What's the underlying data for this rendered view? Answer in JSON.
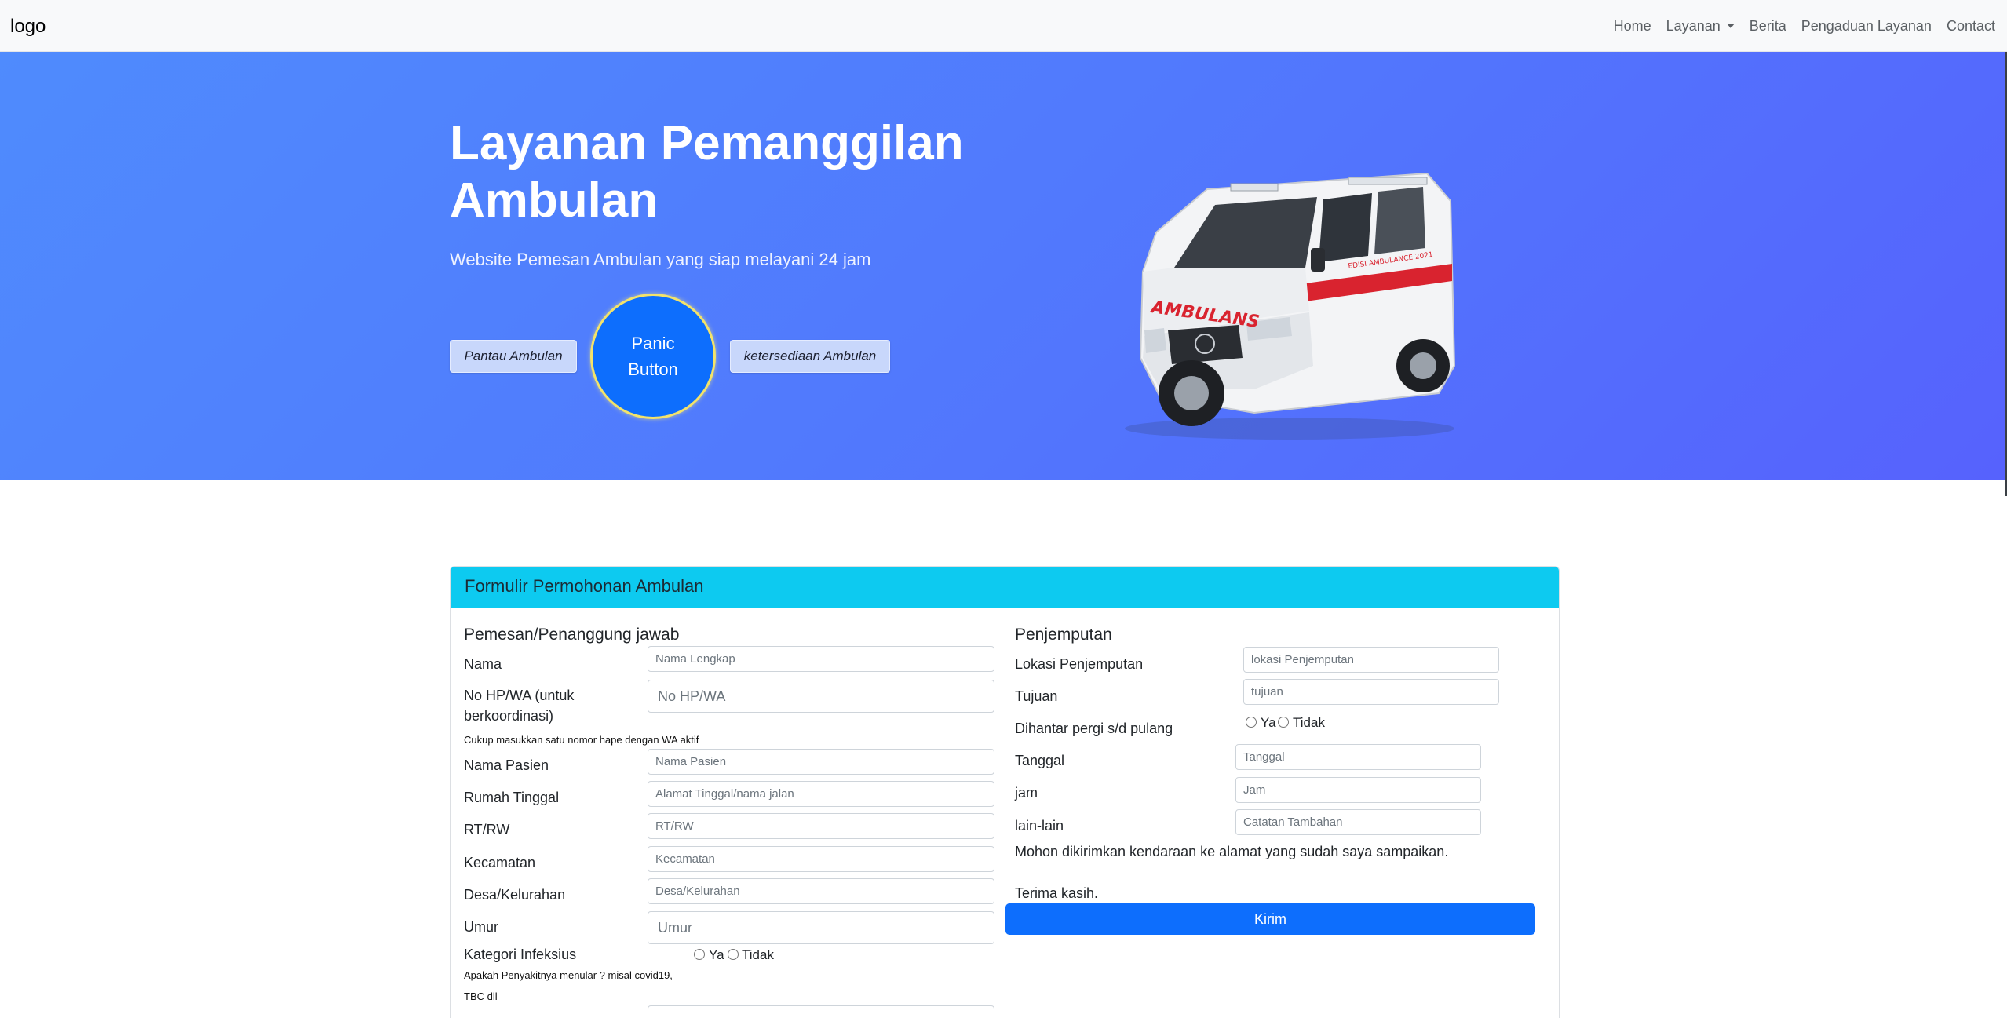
{
  "navbar": {
    "brand": "logo",
    "links": [
      "Home",
      "Layanan",
      "Berita",
      "Pengaduan Layanan",
      "Contact"
    ]
  },
  "hero": {
    "title": "Layanan Pemanggilan Ambulan",
    "subtitle": "Website Pemesan Ambulan yang siap melayani 24 jam",
    "btn_pantau": "Pantau Ambulan",
    "btn_panic_line1": "Panic",
    "btn_panic_line2": "Button",
    "btn_ketersediaan": "ketersediaan Ambulan",
    "ambulance_text": "AMBULANS",
    "ambulance_side_text": "EDISI AMBULANCE 2021"
  },
  "form": {
    "title": "Formulir Permohonan Ambulan",
    "left": {
      "section": "Pemesan/Penanggung jawab",
      "nama_label": "Nama",
      "nama_placeholder": "Nama Lengkap",
      "hp_label_1": "No HP/WA (untuk",
      "hp_label_2": "berkoordinasi)",
      "hp_placeholder": "No HP/WA",
      "hp_help": "Cukup masukkan satu nomor hape dengan WA aktif",
      "pasien_label": "Nama Pasien",
      "pasien_placeholder": "Nama Pasien",
      "rumah_label": "Rumah Tinggal",
      "rumah_placeholder": "Alamat Tinggal/nama jalan",
      "rtrw_label": "RT/RW",
      "rtrw_placeholder": "RT/RW",
      "kecamatan_label": "Kecamatan",
      "kecamatan_placeholder": "Kecamatan",
      "desa_label": "Desa/Kelurahan",
      "desa_placeholder": "Desa/Kelurahan",
      "umur_label": "Umur",
      "umur_placeholder": "Umur",
      "infeksi_label": "Kategori Infeksius",
      "ya": "Ya",
      "tidak": "Tidak",
      "infeksi_help_1": "Apakah Penyakitnya menular ? misal covid19,",
      "infeksi_help_2": "TBC dll"
    },
    "right": {
      "section": "Penjemputan",
      "lokasi_label": "Lokasi Penjemputan",
      "lokasi_placeholder": "lokasi Penjemputan",
      "tujuan_label": "Tujuan",
      "tujuan_placeholder": "tujuan",
      "antar_label": "Dihantar pergi s/d pulang",
      "ya": "Ya",
      "tidak": "Tidak",
      "tanggal_label": "Tanggal",
      "tanggal_placeholder": "Tanggal",
      "jam_label": "jam",
      "jam_placeholder": "Jam",
      "lain_label": "lain-lain",
      "lain_placeholder": "Catatan Tambahan",
      "note": "Mohon dikirimkan kendaraan ke alamat yang sudah saya sampaikan.",
      "thanks": "Terima kasih.",
      "submit": "Kirim"
    }
  },
  "colors": {
    "navbar_bg": "#f8f9fa",
    "hero_gradient_start": "#4f8bfd",
    "hero_gradient_end": "#5662fd",
    "primary": "#0d6efd",
    "card_header": "#0dcaf0"
  }
}
